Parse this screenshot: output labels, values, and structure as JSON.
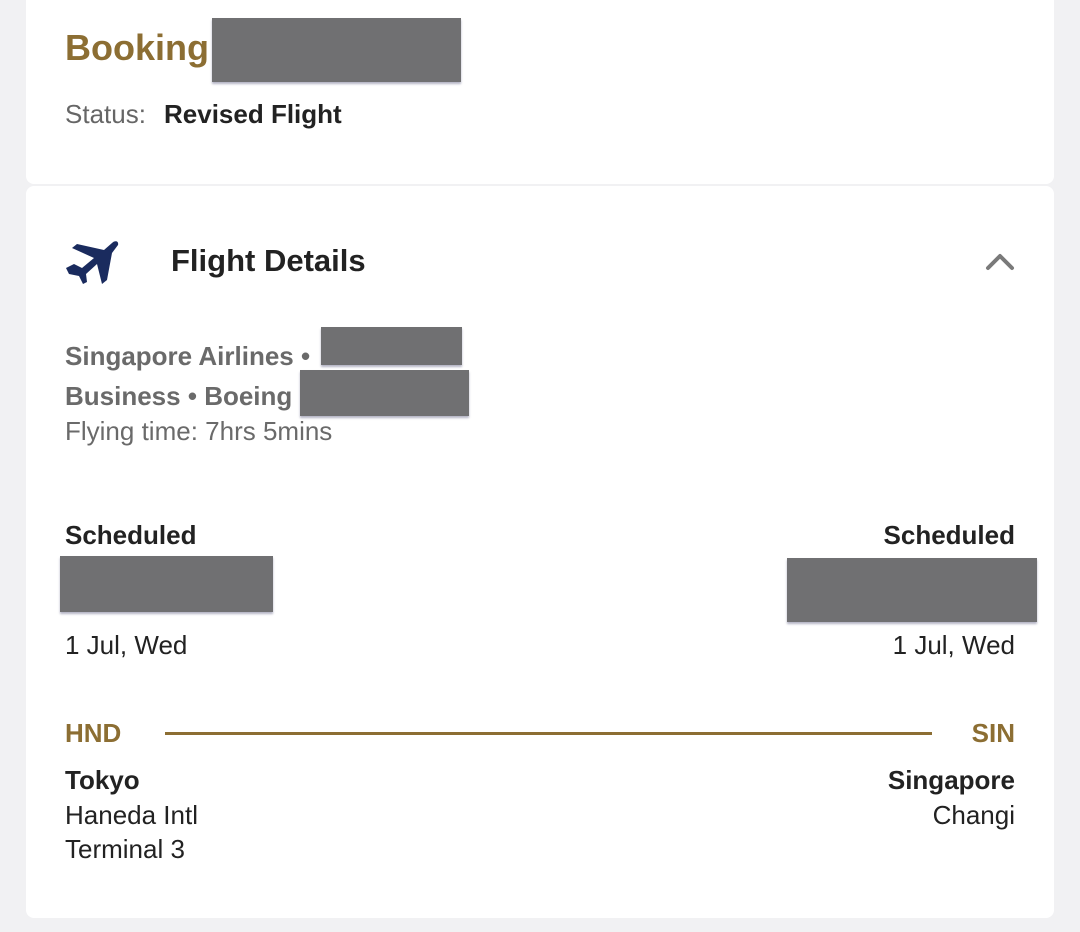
{
  "booking": {
    "title": "Booking",
    "status_label": "Status:",
    "status_value": "Revised Flight"
  },
  "flight_details": {
    "section_title": "Flight Details",
    "icons": {
      "section": "airplane-icon",
      "toggle": "chevron-up-icon"
    },
    "airline": "Singapore Airlines •",
    "cabin": "Business",
    "aircraft": "Boeing",
    "separator": "•",
    "flying_time": "Flying time: 7hrs 5mins",
    "departure": {
      "status": "Scheduled",
      "date": "1 Jul, Wed",
      "code": "HND",
      "city": "Tokyo",
      "airport": "Haneda Intl",
      "terminal": "Terminal 3"
    },
    "arrival": {
      "status": "Scheduled",
      "date": "1 Jul, Wed",
      "code": "SIN",
      "city": "Singapore",
      "airport": "Changi"
    }
  },
  "colors": {
    "accent": "#8c6e33",
    "icon": "#1a2b5e",
    "redaction": "#707072"
  }
}
